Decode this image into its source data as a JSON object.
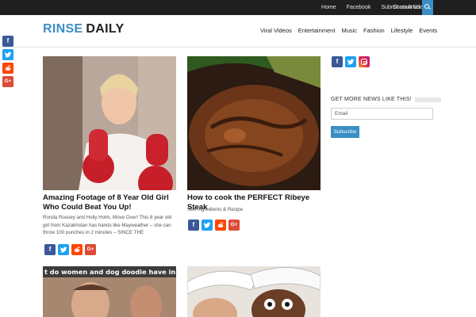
{
  "topbar": {
    "links": [
      "Home",
      "Facebook",
      "Submit an Article"
    ],
    "contact_label": "Contact Us",
    "contact_caret": "▾"
  },
  "logo": {
    "part1": "RINSE",
    "part2": "DAILY"
  },
  "nav": {
    "items": [
      "Viral Videos",
      "Entertainment",
      "Music",
      "Fashion",
      "Lifestyle",
      "Events"
    ]
  },
  "float_share": {
    "facebook_glyph": "f",
    "gplus_glyph": "G+"
  },
  "articles": [
    {
      "title": "Amazing Footage of 8 Year Old Girl Who Could Beat You Up!",
      "excerpt": "Ronda Rousey and Holly Holm, Move Over! This 8 year old girl from Kazakhstan has hands like Mayweather – she can throw 100 punches in 2 minutes – SINCE THE"
    },
    {
      "title": "How to cook the PERFECT Ribeye Steak",
      "excerpt": "See Ingredients & Recipe"
    },
    {
      "image_caption": "t do women and dog doodie have in comm"
    },
    {}
  ],
  "sidebar": {
    "newsletter_heading": "GET MORE NEWS LIKE THIS!",
    "email_placeholder": "Email",
    "subscribe_label": "Subscribe"
  },
  "colors": {
    "accent": "#3a8ec4",
    "topbar": "#1f1f1f",
    "facebook": "#3b5998",
    "twitter": "#1da1f2",
    "reddit": "#ff4500",
    "google_plus": "#dd4b39"
  }
}
